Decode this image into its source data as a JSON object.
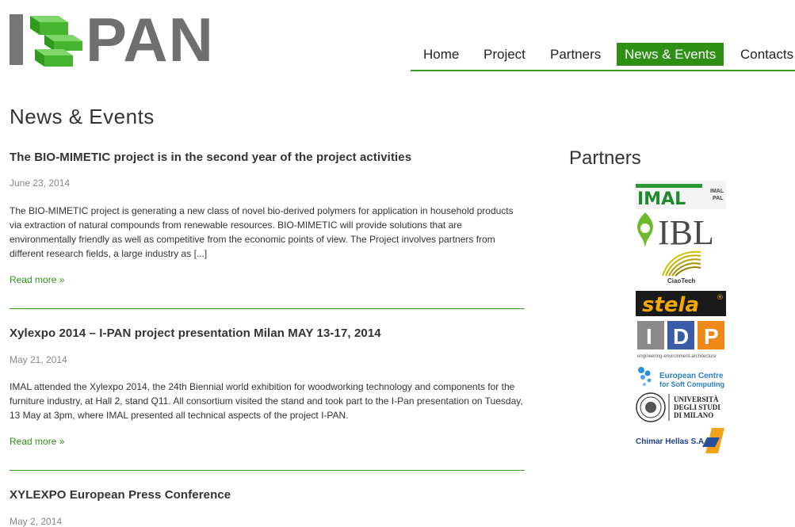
{
  "logo": {
    "text": "PAN"
  },
  "nav": [
    {
      "label": "Home"
    },
    {
      "label": "Project"
    },
    {
      "label": "Partners"
    },
    {
      "label": "News & Events"
    },
    {
      "label": "Contacts"
    }
  ],
  "page_title": "News & Events",
  "posts": [
    {
      "title": "The BIO-MIMETIC project is in the second year of the project activities",
      "date": "June 23, 2014",
      "excerpt": "The BIO-MIMETIC project is generating a new class of novel bio-derived polymers for application in household products via extraction of natural compounds from renewable resources. BIO-MIMETIC will provide solutions that are environmentally friendly as well as competitive from the economic points of view. The Project involves  partners from different research fields, a large industry as [...]",
      "more": "Read more »"
    },
    {
      "title": "Xylexpo 2014 – I-PAN project presentation Milan MAY 13-17, 2014",
      "date": "May 21, 2014",
      "excerpt": "IMAL attended the Xylexpo 2014, the 24th Biennial world exhibition for woodworking technology and components for the furniture industry, at Hall 2, stand Q11. All consortium visited the stand and took part to the I-Pan presentation on Tuesday, 13 May at 3pm, where IMAL presented all technical aspects of the project I-PAN.",
      "more": "Read more »"
    },
    {
      "title": "XYLEXPO European Press Conference",
      "date": "May 2, 2014"
    }
  ],
  "sidebar": {
    "title": "Partners",
    "logos": {
      "imal": {
        "text": "IMAL",
        "sub1": "IMAL",
        "sub2": "PAL"
      },
      "ibl": {
        "text": "IBL"
      },
      "ciaotech": {
        "text": "CiaoTech"
      },
      "stela": {
        "text": "stela",
        "mark": "®"
      },
      "idp": {
        "letters": [
          "I",
          "D",
          "P"
        ],
        "tagline": "engineering-environment-architecture"
      },
      "ecsc": {
        "line1": "European Centre",
        "line2": "for Soft Computing"
      },
      "unimi": {
        "line1": "UNIVERSITÀ",
        "line2": "DEGLI STUDI",
        "line3": "DI MILANO"
      },
      "chimar": {
        "text": "Chimar Hellas S.A."
      }
    }
  },
  "colors": {
    "accent": "#2e8f17",
    "logo_gray": "#6f6f6f",
    "logo_green": "#3aa82a"
  }
}
